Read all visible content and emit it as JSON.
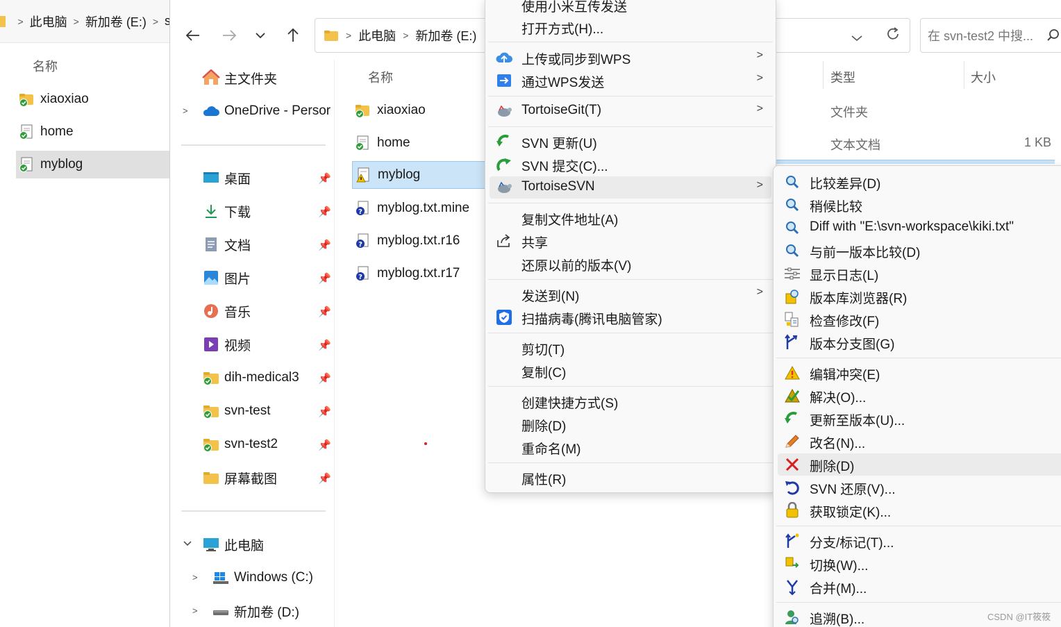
{
  "back_window": {
    "crumbs": [
      "此电脑",
      "新加卷 (E:)",
      "s"
    ],
    "column_name": "名称",
    "files": [
      {
        "name": "xiaoxiao",
        "icon": "svn-folder-icon"
      },
      {
        "name": "home",
        "icon": "svn-file-ok-icon"
      },
      {
        "name": "myblog",
        "icon": "svn-file-ok-icon"
      }
    ]
  },
  "main_window": {
    "address_crumbs": [
      "此电脑",
      "新加卷 (E:)"
    ],
    "search_placeholder": "在 svn-test2 中搜...",
    "nav_pane": {
      "home": "主文件夹",
      "onedrive": "OneDrive - Persor",
      "quick_access": [
        {
          "label": "桌面",
          "icon": "desktop-icon"
        },
        {
          "label": "下载",
          "icon": "download-icon"
        },
        {
          "label": "文档",
          "icon": "document-icon"
        },
        {
          "label": "图片",
          "icon": "pictures-icon"
        },
        {
          "label": "音乐",
          "icon": "music-icon"
        },
        {
          "label": "视频",
          "icon": "video-icon"
        },
        {
          "label": "dih-medical3",
          "icon": "svn-folder-icon"
        },
        {
          "label": "svn-test",
          "icon": "svn-folder-icon"
        },
        {
          "label": "svn-test2",
          "icon": "svn-folder-icon"
        },
        {
          "label": "屏幕截图",
          "icon": "folder-icon"
        }
      ],
      "this_pc": "此电脑",
      "drives": [
        "Windows (C:)",
        "新加卷 (D:)"
      ]
    },
    "columns": {
      "name": "名称",
      "type": "类型",
      "size": "大小"
    },
    "files": [
      {
        "name": "xiaoxiao",
        "type": "文件夹",
        "size": "",
        "icon": "svn-folder-icon"
      },
      {
        "name": "home",
        "type": "文本文档",
        "size": "1 KB",
        "icon": "svn-file-ok-icon"
      },
      {
        "name": "myblog",
        "type": "",
        "size": "",
        "icon": "svn-conflict-file-icon"
      },
      {
        "name": "myblog.txt.mine",
        "type": "",
        "size": "",
        "icon": "svn-unversioned-icon"
      },
      {
        "name": "myblog.txt.r16",
        "type": "",
        "size": "",
        "icon": "svn-unversioned-icon"
      },
      {
        "name": "myblog.txt.r17",
        "type": "",
        "size": "",
        "icon": "svn-unversioned-icon"
      }
    ]
  },
  "context_menu": {
    "items": [
      {
        "label": "使用小米互传发送"
      },
      {
        "label": "打开方式(H)..."
      },
      {
        "label": "上传或同步到WPS",
        "icon": "cloud-upload-icon",
        "submenu": true
      },
      {
        "label": "通过WPS发送",
        "icon": "wps-send-icon",
        "submenu": true
      },
      {
        "label": "TortoiseGit(T)",
        "icon": "tortoise-git-icon",
        "submenu": true
      },
      {
        "label": "SVN 更新(U)",
        "icon": "svn-update-icon"
      },
      {
        "label": "SVN 提交(C)...",
        "icon": "svn-commit-icon"
      },
      {
        "label": "TortoiseSVN",
        "icon": "tortoise-svn-icon",
        "submenu": true
      },
      {
        "label": "复制文件地址(A)"
      },
      {
        "label": "共享",
        "icon": "share-icon"
      },
      {
        "label": "还原以前的版本(V)"
      },
      {
        "label": "发送到(N)",
        "submenu": true
      },
      {
        "label": "扫描病毒(腾讯电脑管家)",
        "icon": "shield-icon"
      },
      {
        "label": "剪切(T)"
      },
      {
        "label": "复制(C)"
      },
      {
        "label": "创建快捷方式(S)"
      },
      {
        "label": "删除(D)"
      },
      {
        "label": "重命名(M)"
      },
      {
        "label": "属性(R)"
      }
    ]
  },
  "svn_submenu": {
    "items": [
      {
        "label": "比较差异(D)",
        "icon": "diff-icon"
      },
      {
        "label": "稍候比较",
        "icon": "diff-later-icon"
      },
      {
        "label": "Diff with \"E:\\svn-workspace\\kiki.txt\"",
        "icon": "diff-with-icon"
      },
      {
        "label": "与前一版本比较(D)",
        "icon": "diff-previous-icon"
      },
      {
        "label": "显示日志(L)",
        "icon": "log-icon"
      },
      {
        "label": "版本库浏览器(R)",
        "icon": "repo-browser-icon"
      },
      {
        "label": "检查修改(F)",
        "icon": "check-modifications-icon"
      },
      {
        "label": "版本分支图(G)",
        "icon": "revision-graph-icon"
      },
      {
        "label": "编辑冲突(E)",
        "icon": "conflict-icon"
      },
      {
        "label": "解决(O)...",
        "icon": "resolve-icon"
      },
      {
        "label": "更新至版本(U)...",
        "icon": "update-to-revision-icon"
      },
      {
        "label": "改名(N)...",
        "icon": "rename-icon"
      },
      {
        "label": "删除(D)",
        "icon": "delete-icon"
      },
      {
        "label": "SVN 还原(V)...",
        "icon": "revert-icon"
      },
      {
        "label": "获取锁定(K)...",
        "icon": "lock-icon"
      },
      {
        "label": "分支/标记(T)...",
        "icon": "branch-icon"
      },
      {
        "label": "切换(W)...",
        "icon": "switch-icon"
      },
      {
        "label": "合并(M)...",
        "icon": "merge-icon"
      },
      {
        "label": "追溯(B)...",
        "icon": "blame-icon"
      }
    ]
  },
  "watermark": "CSDN @IT筱筱"
}
